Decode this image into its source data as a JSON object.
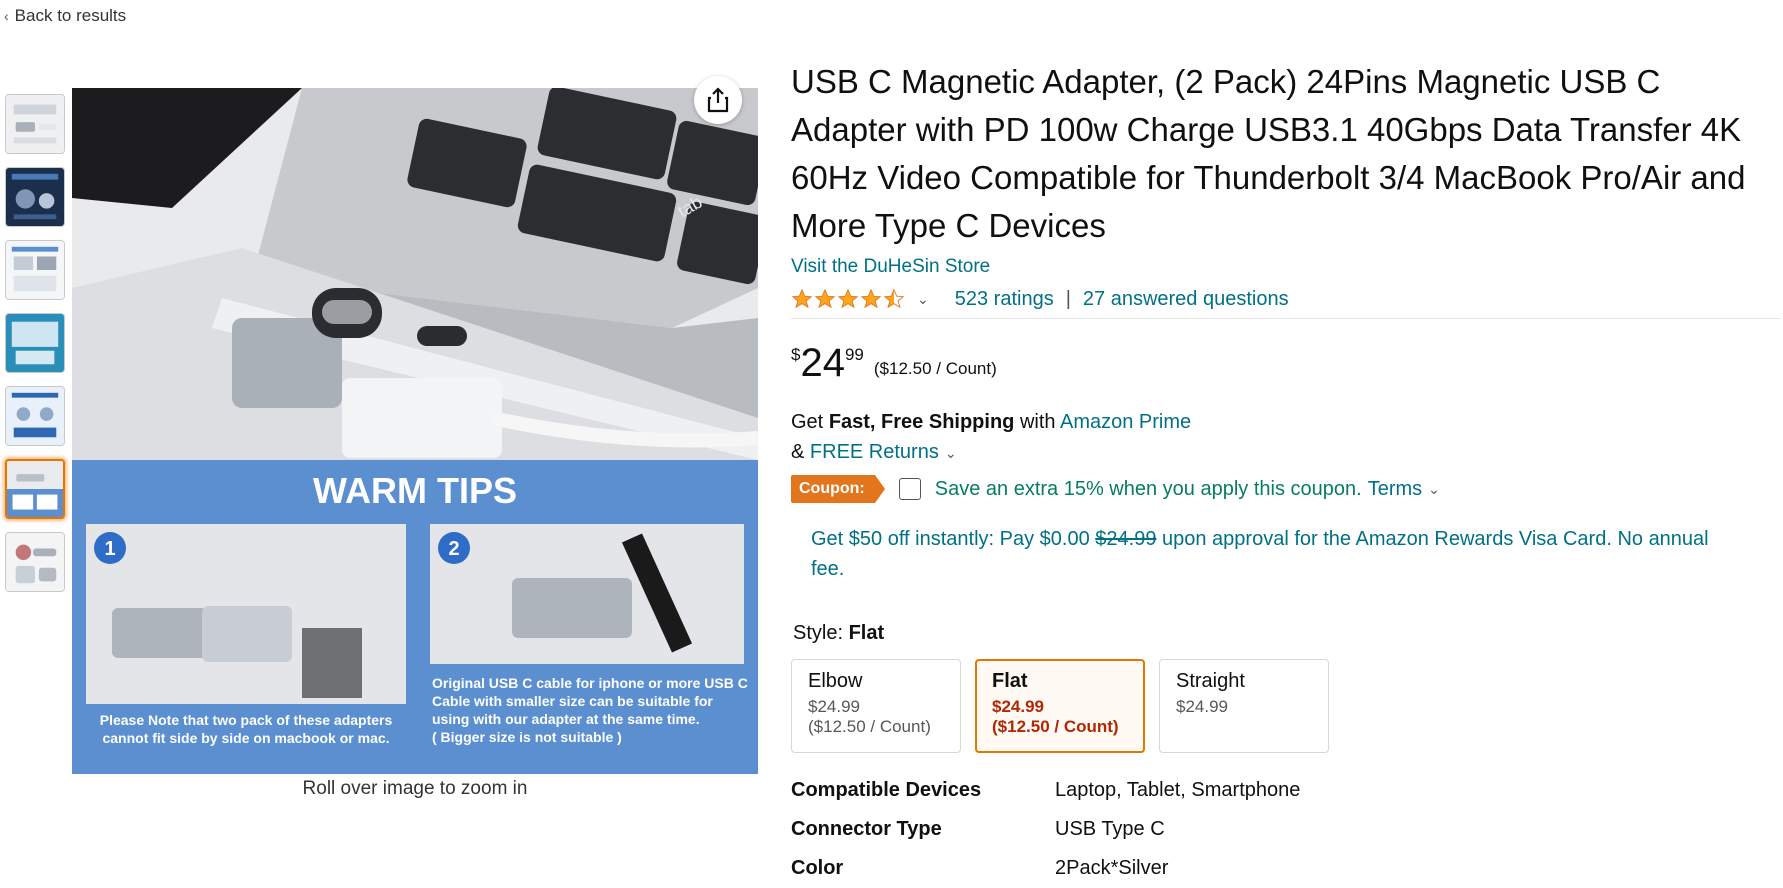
{
  "nav": {
    "back_label": "Back to results"
  },
  "gallery": {
    "thumbnail_count": 7,
    "active_index": 5,
    "zoom_hint": "Roll over image to zoom in",
    "main_image": {
      "banner_title": "WARM TIPS",
      "step1": "1",
      "step2": "2",
      "note_left_1": "Please Note that two pack of these adapters",
      "note_left_2": "cannot fit side by side on macbook or mac.",
      "note_right_1": "Original USB C cable for iphone or more USB C",
      "note_right_2": "Cable with smaller size can be suitable for",
      "note_right_3": "using with our adapter at the same time.",
      "note_right_4": "( Bigger size is not suitable )",
      "key_label": "tab"
    }
  },
  "product": {
    "title": "USB C Magnetic Adapter, (2 Pack) 24Pins Magnetic USB C Adapter with PD 100w Charge USB3.1 40Gbps Data Transfer 4K 60Hz Video Compatible for Thunderbolt 3/4 MacBook Pro/Air and More Type C Devices",
    "store_link": "Visit the DuHeSin Store",
    "rating_stars": 4.5,
    "ratings_count": "523 ratings",
    "separator": "|",
    "answered_questions": "27 answered questions"
  },
  "price": {
    "symbol": "$",
    "whole": "24",
    "fraction": "99",
    "per_unit": "($12.50 / Count)"
  },
  "shipping": {
    "get": "Get",
    "fast_free": "Fast, Free Shipping",
    "with": "with",
    "prime_link": "Amazon Prime",
    "amp": "&",
    "returns_link": "FREE Returns"
  },
  "coupon": {
    "badge": "Coupon:",
    "text": "Save an extra 15% when you apply this coupon.",
    "terms": "Terms"
  },
  "card_offer": {
    "prefix": "Get $50 off instantly: Pay $0.00",
    "strike": "$24.99",
    "suffix": "upon approval for the Amazon Rewards Visa Card. No annual fee."
  },
  "style": {
    "label": "Style:",
    "selected": "Flat",
    "options": [
      {
        "name": "Elbow",
        "price": "$24.99",
        "per_unit": "($12.50 / Count)"
      },
      {
        "name": "Flat",
        "price": "$24.99",
        "per_unit": "($12.50 / Count)"
      },
      {
        "name": "Straight",
        "price": "$24.99",
        "per_unit": ""
      }
    ]
  },
  "specs": [
    {
      "key": "Compatible Devices",
      "value": "Laptop, Tablet, Smartphone"
    },
    {
      "key": "Connector Type",
      "value": "USB Type C"
    },
    {
      "key": "Color",
      "value": "2Pack*Silver"
    }
  ],
  "colors": {
    "link": "#007185",
    "coupon_orange": "#e3751c",
    "coupon_green": "#067D62",
    "selected_border": "#e77600",
    "star": "#FFA41C",
    "image_blue": "#5b8fcf"
  }
}
